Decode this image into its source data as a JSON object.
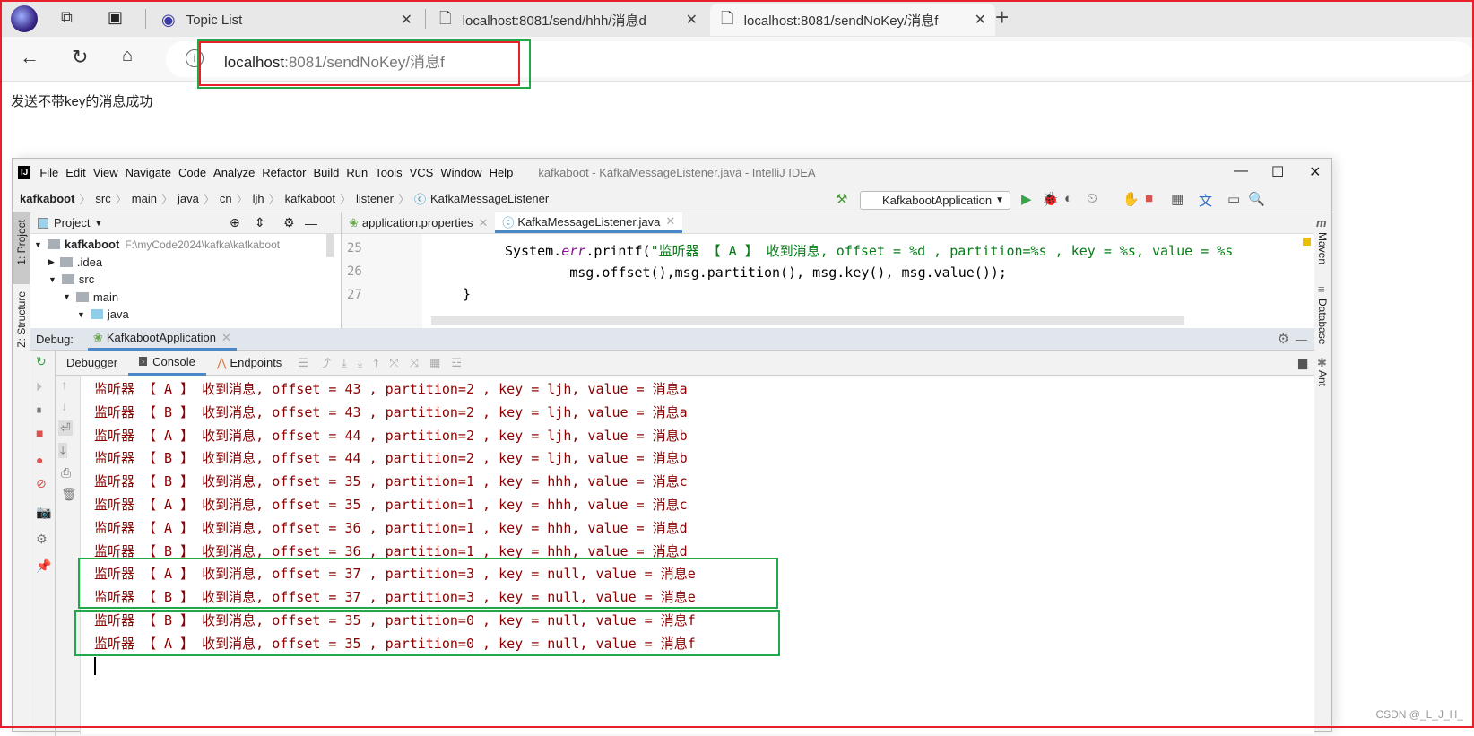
{
  "browser": {
    "tabs": [
      {
        "label": "Topic List",
        "icon": "topic-icon"
      },
      {
        "label": "localhost:8081/send/hhh/消息d",
        "icon": "page-icon"
      },
      {
        "label": "localhost:8081/sendNoKey/消息f",
        "icon": "page-icon",
        "active": true
      }
    ],
    "new_tab": "+",
    "url_host": "localhost",
    "url_rest": ":8081/sendNoKey/消息f"
  },
  "page": {
    "message": "发送不带key的消息成功"
  },
  "ide": {
    "logo": "IJ",
    "menu": [
      "File",
      "Edit",
      "View",
      "Navigate",
      "Code",
      "Analyze",
      "Refactor",
      "Build",
      "Run",
      "Tools",
      "VCS",
      "Window",
      "Help"
    ],
    "title": "kafkaboot - KafkaMessageListener.java - IntelliJ IDEA",
    "breadcrumbs": [
      "kafkaboot",
      "src",
      "main",
      "java",
      "cn",
      "ljh",
      "kafkaboot",
      "listener",
      "KafkaMessageListener"
    ],
    "run_config": "KafkabootApplication",
    "left_strip": [
      "1: Project",
      "Z: Structure"
    ],
    "right_strip": [
      "Maven",
      "Database",
      "Ant"
    ],
    "project": {
      "header": "Project",
      "tree": [
        {
          "name": "kafkaboot",
          "path": "F:\\myCode2024\\kafka\\kafkaboot"
        },
        {
          "name": ".idea"
        },
        {
          "name": "src"
        },
        {
          "name": "main"
        },
        {
          "name": "java"
        }
      ]
    },
    "editor": {
      "tabs": [
        "application.properties",
        "KafkaMessageListener.java"
      ],
      "line_numbers": [
        "25",
        "26",
        "27"
      ],
      "code": [
        {
          "pre": "System.",
          "err": "err",
          "mid": ".printf(",
          "str": "\"监听器 【 A 】 收到消息, offset = %d , partition=%s , key = %s, value = %s"
        },
        {
          "plain": "        msg.offset(),msg.partition(), msg.key(), msg.value());"
        },
        {
          "plain": "}"
        }
      ]
    },
    "debug": {
      "label": "Debug:",
      "session": "KafkabootApplication",
      "tabs": [
        "Debugger",
        "Console",
        "Endpoints"
      ],
      "active_tab": "Console",
      "console_lines": [
        "监听器 【 A 】 收到消息, offset = 43 , partition=2 , key = ljh, value = 消息a",
        "监听器 【 B 】 收到消息, offset = 43 , partition=2 , key = ljh, value = 消息a",
        "监听器 【 A 】 收到消息, offset = 44 , partition=2 , key = ljh, value = 消息b",
        "监听器 【 B 】 收到消息, offset = 44 , partition=2 , key = ljh, value = 消息b",
        "监听器 【 B 】 收到消息, offset = 35 , partition=1 , key = hhh, value = 消息c",
        "监听器 【 A 】 收到消息, offset = 35 , partition=1 , key = hhh, value = 消息c",
        "监听器 【 A 】 收到消息, offset = 36 , partition=1 , key = hhh, value = 消息d",
        "监听器 【 B 】 收到消息, offset = 36 , partition=1 , key = hhh, value = 消息d",
        "监听器 【 A 】 收到消息, offset = 37 , partition=3 , key = null, value = 消息e",
        "监听器 【 B 】 收到消息, offset = 37 , partition=3 , key = null, value = 消息e",
        "监听器 【 B 】 收到消息, offset = 35 , partition=0 , key = null, value = 消息f",
        "监听器 【 A 】 收到消息, offset = 35 , partition=0 , key = null, value = 消息f"
      ]
    }
  },
  "watermark": "CSDN @_L_J_H_",
  "colors": {
    "annotation_red": "#e8202a",
    "annotation_green": "#21a84a",
    "console_text": "#8b0000",
    "accent": "#4a88c7"
  }
}
